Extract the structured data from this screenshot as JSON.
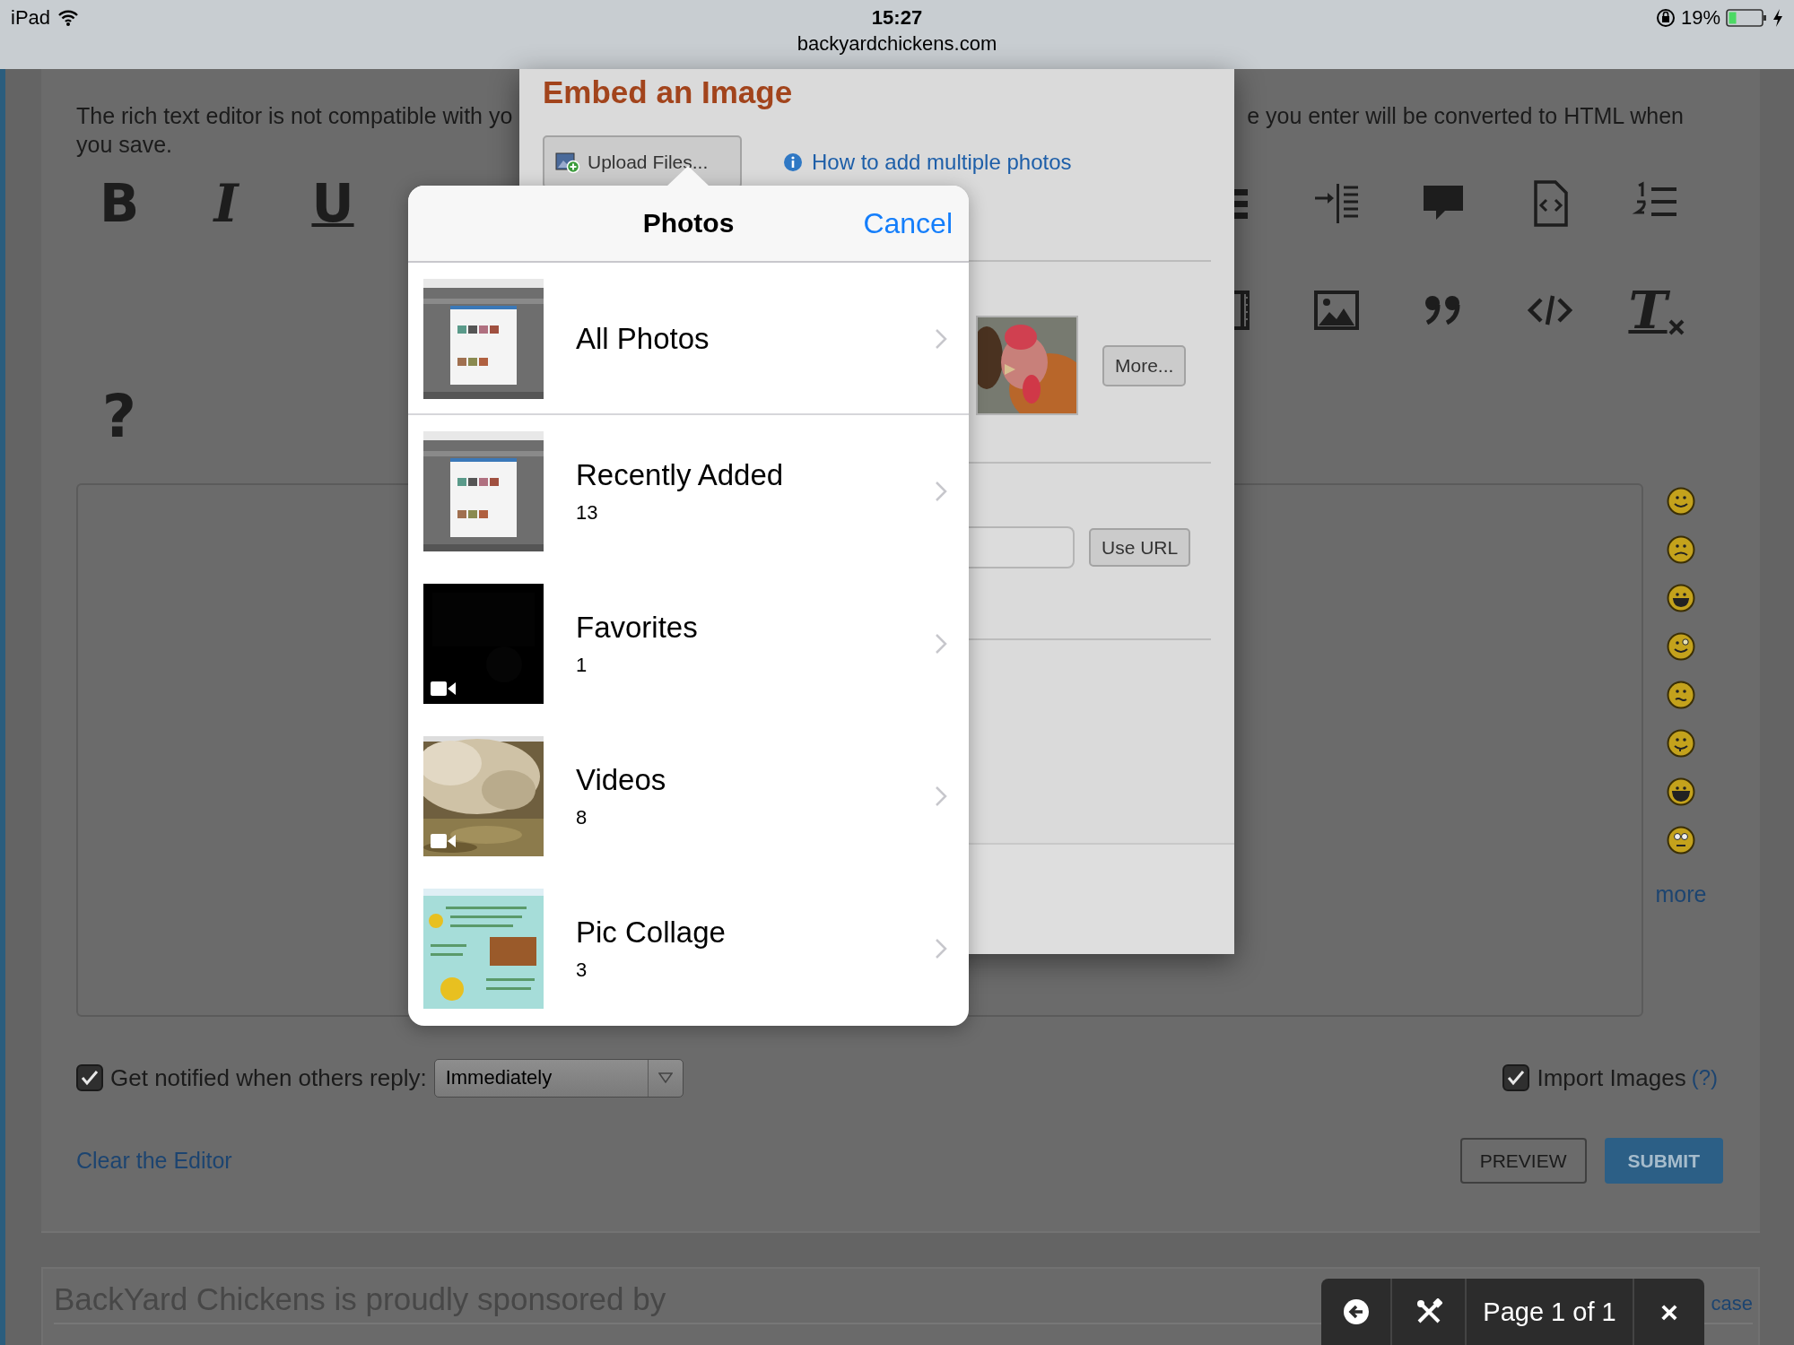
{
  "status_bar": {
    "device": "iPad",
    "time": "15:27",
    "url": "backyardchickens.com",
    "battery": "19%"
  },
  "editor_page": {
    "notice": [
      "The rich text editor is not compatible with yo",
      "e you enter will be converted to HTML when",
      "you save."
    ],
    "toolbar": [
      {
        "glyph": "B",
        "kind": "bold"
      },
      {
        "glyph": "I",
        "kind": "italic"
      },
      {
        "glyph": "U",
        "kind": "underline"
      },
      {
        "glyph": "T",
        "kind": "clear"
      },
      {
        "glyph": "?",
        "kind": "help"
      }
    ],
    "smilies_link": "more",
    "notify": {
      "checked": true,
      "label": "Get notified when others reply:",
      "frequency": "Immediately"
    },
    "import_images": {
      "checked": true,
      "label": "Import Images",
      "help_link": "(?)"
    },
    "clear_link": "Clear the Editor",
    "buttons": [
      {
        "label": "PREVIEW",
        "kind": "secondary"
      },
      {
        "label": "SUBMIT",
        "kind": "primary"
      }
    ],
    "sponsor_heading": "BackYard Chickens is proudly sponsored by",
    "sponsor_link": "case"
  },
  "embed_dialog": {
    "title": "Embed an Image",
    "upload_button": "Upload Files...",
    "help_link": "How to add multiple photos",
    "more_button": "More...",
    "url_button": "Use URL"
  },
  "photos_picker": {
    "title": "Photos",
    "cancel": "Cancel",
    "albums": [
      {
        "name": "All Photos",
        "video": false
      },
      {
        "name": "Recently Added",
        "count": "13",
        "video": false
      },
      {
        "name": "Favorites",
        "count": "1",
        "video": true
      },
      {
        "name": "Videos",
        "count": "8",
        "video": true
      },
      {
        "name": "Pic Collage",
        "count": "3",
        "video": false
      }
    ]
  },
  "reader_bar": {
    "page_label": "Page 1 of 1",
    "close": "×"
  }
}
